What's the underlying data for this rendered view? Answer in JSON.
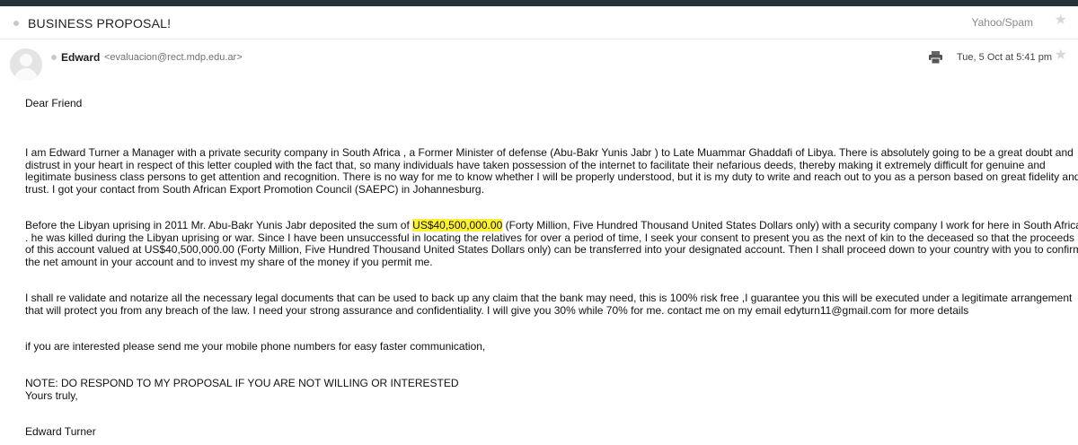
{
  "header": {
    "subject": "BUSINESS PROPOSAL!",
    "folder": "Yahoo/Spam"
  },
  "sender": {
    "name": "Edward",
    "email": "<evaluacion@rect.mdp.edu.ar>",
    "date": "Tue, 5 Oct at 5:41 pm"
  },
  "icons": {
    "print": "printer-icon",
    "star": "star-icon",
    "avatar": "user-avatar-icon"
  },
  "colors": {
    "topbar": "#26323a",
    "highlight": "#fff22e"
  },
  "body": {
    "greeting": "Dear Friend",
    "p1": [
      "I am Edward Turner a Manager with a private security company in South Africa  , a Former Minister of defense (Abu-Bakr Yunis Jabr ) to Late Muammar Ghaddafi of Libya. There is absolutely going to be a great doubt and",
      "distrust in your heart in respect of this letter coupled with the fact that, so many individuals have taken possession of the internet to facilitate their nefarious deeds, thereby making it extremely difficult for genuine and",
      "legitimate business class persons to get attention and recognition. There is no way for me to know whether I will be properly understood, but it is my duty to write and reach out to you as a person based on great fidelity and",
      "trust. I got your contact from South African Export Promotion Council (SAEPC) in Johannesburg."
    ],
    "p2_line1_before": "Before the Libyan uprising in 2011 Mr. Abu-Bakr Yunis Jabr deposited the sum of ",
    "p2_amount": "US$40,500,000.00",
    "p2_line1_after": " (Forty Million, Five Hundred Thousand United States Dollars only) with a security company I work for here in South Africa",
    "p2_rest": [
      ". he was killed during the Libyan uprising or war. Since I have been unsuccessful in locating the relatives for over a period of time, I seek your consent to present you as the next of kin to the deceased so that the proceeds",
      "of this account valued at US$40,500,000.00 (Forty Million, Five Hundred Thousand United States Dollars only) can be transferred into your designated account. Then I shall proceed down to your country with you to confirm",
      "the net amount in your account and to invest my share of the money if you permit me."
    ],
    "p3": [
      "I shall re validate and notarize all the necessary legal documents that can be used to back up any claim that the bank may need, this is 100% risk free ,I guarantee you this will be executed under a legitimate arrangement",
      "that will protect you from any breach of the law. I need your strong assurance and confidentiality. I will give you 30% while 70% for me. contact me on my email   edyturn11@gmail.com  for more details"
    ],
    "p4": "if you are interested please send me your mobile phone numbers for easy faster communication,",
    "note": "NOTE: DO RESPOND TO MY PROPOSAL IF YOU ARE NOT WILLING OR INTERESTED",
    "closing": "Yours truly,",
    "signature": "Edward Turner"
  }
}
